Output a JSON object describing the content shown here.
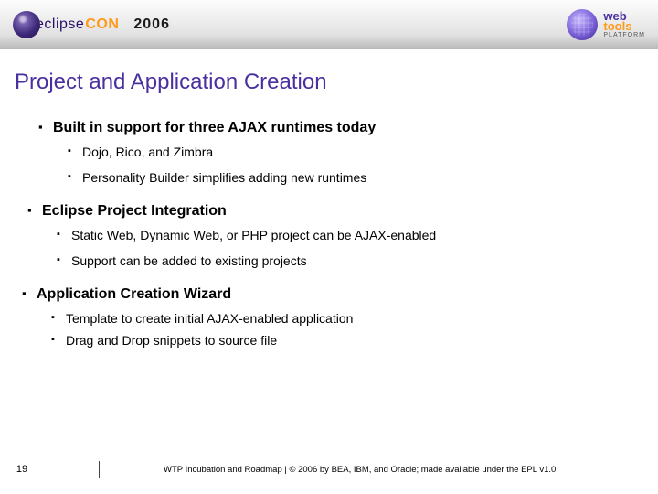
{
  "header": {
    "brand_left_a": "eclipse",
    "brand_left_b": "CON",
    "year": "2006",
    "brand_right_a": "web",
    "brand_right_b": "tools",
    "brand_right_sub": "PLATFORM"
  },
  "title": "Project and Application Creation",
  "sections": [
    {
      "heading": "Built in support for three AJAX runtimes today",
      "items": [
        "Dojo, Rico, and Zimbra",
        "Personality Builder simplifies adding new runtimes"
      ]
    },
    {
      "heading": "Eclipse Project Integration",
      "items": [
        "Static Web, Dynamic Web, or PHP project can be AJAX-enabled",
        "Support can be added to existing projects"
      ]
    },
    {
      "heading": "Application Creation Wizard",
      "items": [
        "Template to create initial AJAX-enabled application",
        "Drag and Drop snippets to source file"
      ]
    }
  ],
  "footer": {
    "page": "19",
    "text": "WTP Incubation and Roadmap  |  © 2006 by BEA, IBM, and Oracle; made available under the EPL v1.0"
  }
}
